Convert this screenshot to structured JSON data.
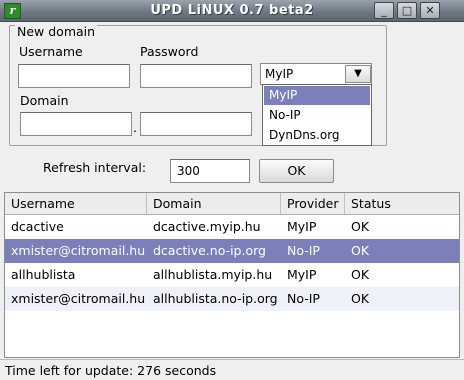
{
  "window": {
    "title": "UPD LiNUX 0.7 beta2",
    "app_icon_glyph": "r",
    "buttons": {
      "minimize": "_",
      "maximize": "□",
      "close": "✕"
    }
  },
  "new_domain": {
    "legend": "New domain",
    "username_label": "Username",
    "password_label": "Password",
    "domain_label": "Domain",
    "username_value": "",
    "password_value": "",
    "domain_name_value": "",
    "domain_dot": ".",
    "domain_suffix_value": "",
    "provider_selected": "MyIP",
    "provider_options": [
      "MyIP",
      "No-IP",
      "DynDns.org"
    ]
  },
  "refresh": {
    "label": "Refresh interval:",
    "value": "300",
    "ok_label": "OK"
  },
  "table": {
    "columns": [
      "Username",
      "Domain",
      "Provider",
      "Status"
    ],
    "rows": [
      {
        "username": "dcactive",
        "domain": "dcactive.myip.hu",
        "provider": "MyIP",
        "status": "OK"
      },
      {
        "username": "xmister@citromail.hu",
        "domain": "dcactive.no-ip.org",
        "provider": "No-IP",
        "status": "OK"
      },
      {
        "username": "allhublista",
        "domain": "allhublista.myip.hu",
        "provider": "MyIP",
        "status": "OK"
      },
      {
        "username": "xmister@citromail.hu",
        "domain": "allhublista.no-ip.org",
        "provider": "No-IP",
        "status": "OK"
      }
    ],
    "selected_row": 1
  },
  "status_bar": {
    "text": "Time left for update: 276 seconds"
  },
  "colors": {
    "selection": "#7b7fba",
    "titlebar": "#6f7984"
  }
}
